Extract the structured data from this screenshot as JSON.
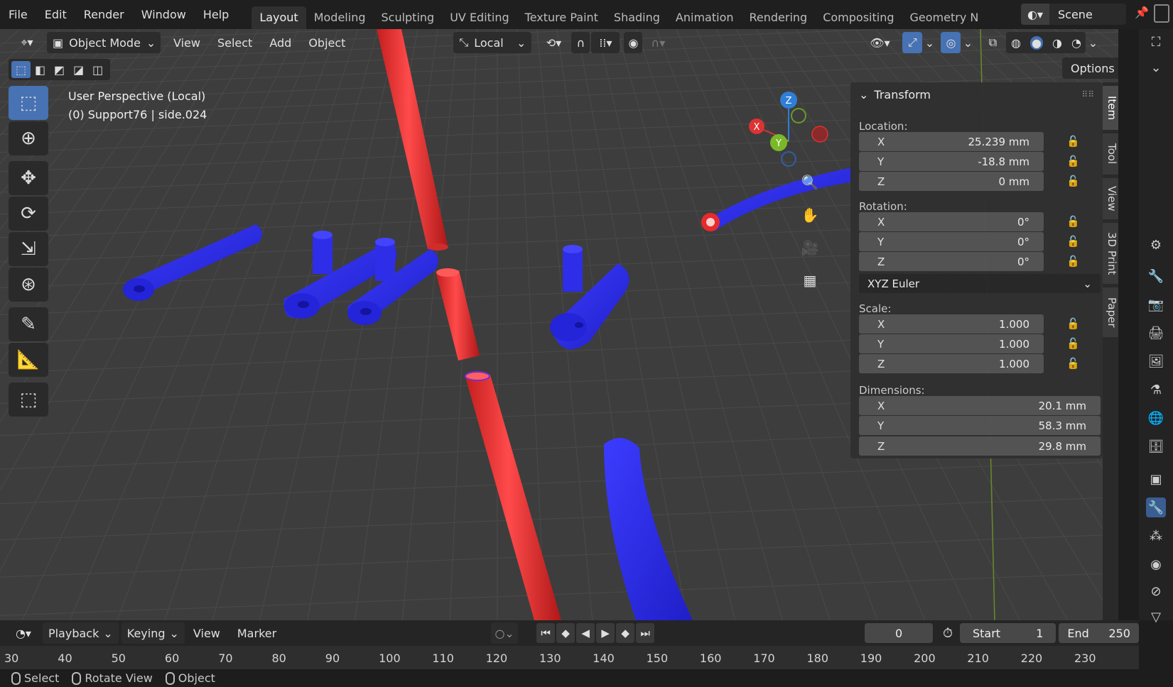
{
  "topbar": {
    "menus": [
      "File",
      "Edit",
      "Render",
      "Window",
      "Help"
    ],
    "workspaces": [
      "Layout",
      "Modeling",
      "Sculpting",
      "UV Editing",
      "Texture Paint",
      "Shading",
      "Animation",
      "Rendering",
      "Compositing",
      "Geometry N"
    ],
    "active_workspace": "Layout",
    "scene_label": "Scene"
  },
  "viewport_header": {
    "mode": "Object Mode",
    "menus": [
      "View",
      "Select",
      "Add",
      "Object"
    ],
    "transform_orientation": "Local",
    "options_label": "Options"
  },
  "viewport_info": {
    "line1": "User Perspective (Local)",
    "line2": "(0) Support76 | side.024"
  },
  "gizmo": {
    "x": "X",
    "y": "Y",
    "z": "Z"
  },
  "npanel": {
    "title": "Transform",
    "location_label": "Location:",
    "location": [
      {
        "axis": "X",
        "value": "25.239 mm"
      },
      {
        "axis": "Y",
        "value": "-18.8 mm"
      },
      {
        "axis": "Z",
        "value": "0 mm"
      }
    ],
    "rotation_label": "Rotation:",
    "rotation": [
      {
        "axis": "X",
        "value": "0°"
      },
      {
        "axis": "Y",
        "value": "0°"
      },
      {
        "axis": "Z",
        "value": "0°"
      }
    ],
    "rotation_mode": "XYZ Euler",
    "scale_label": "Scale:",
    "scale": [
      {
        "axis": "X",
        "value": "1.000"
      },
      {
        "axis": "Y",
        "value": "1.000"
      },
      {
        "axis": "Z",
        "value": "1.000"
      }
    ],
    "dimensions_label": "Dimensions:",
    "dimensions": [
      {
        "axis": "X",
        "value": "20.1 mm"
      },
      {
        "axis": "Y",
        "value": "58.3 mm"
      },
      {
        "axis": "Z",
        "value": "29.8 mm"
      }
    ]
  },
  "sidetabs": [
    "Item",
    "Tool",
    "View",
    "3D Print",
    "Paper"
  ],
  "timeline": {
    "menus": [
      "Playback",
      "Keying",
      "View",
      "Marker"
    ],
    "current_frame": "0",
    "start_label": "Start",
    "start_value": "1",
    "end_label": "End",
    "end_value": "250",
    "ticks": [
      "30",
      "40",
      "50",
      "60",
      "70",
      "80",
      "90",
      "100",
      "110",
      "120",
      "130",
      "140",
      "150",
      "160",
      "170",
      "180",
      "190",
      "200",
      "210",
      "220",
      "230"
    ]
  },
  "statusbar": {
    "items": [
      "Select",
      "Rotate View",
      "Object"
    ]
  },
  "colors": {
    "accent": "#4772b3",
    "support_red": "#e23a3a",
    "part_blue": "#2d2df0"
  }
}
